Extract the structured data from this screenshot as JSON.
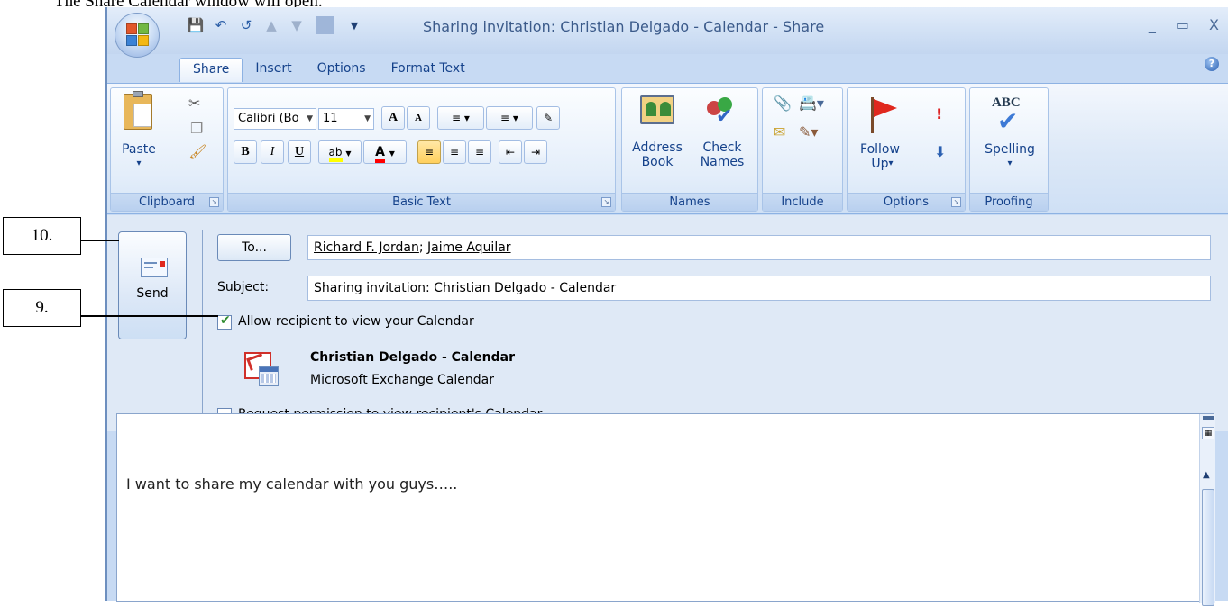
{
  "doc_heading": "The Share Calendar window will open.",
  "window": {
    "title": "Sharing invitation: Christian Delgado - Calendar - Share",
    "controls": [
      "_",
      "▭",
      "X"
    ],
    "help": "?"
  },
  "qat": {
    "save": "save-icon",
    "undo": "undo-icon",
    "redo": "redo-icon",
    "up": "previous-icon",
    "down": "next-icon",
    "customize": "customize-icon"
  },
  "tabs": [
    "Share",
    "Insert",
    "Options",
    "Format Text"
  ],
  "ribbon": {
    "clipboard": {
      "paste": "Paste",
      "paste_arrow": "▾",
      "label": "Clipboard"
    },
    "basic_text": {
      "font": "Calibri (Bo",
      "size": "11",
      "grow": "A",
      "shrink": "A",
      "bold": "B",
      "italic": "I",
      "underline": "U",
      "highlight": "ab",
      "font_color": "A",
      "label": "Basic Text"
    },
    "names": {
      "address_book": "Address Book",
      "check_names": "Check Names",
      "label": "Names"
    },
    "include": {
      "label": "Include"
    },
    "options": {
      "follow_up": "Follow Up",
      "follow_up_arrow": "▾",
      "label": "Options"
    },
    "proofing": {
      "spelling": "Spelling",
      "spelling_arrow": "▾",
      "abc": "ABC",
      "label": "Proofing"
    }
  },
  "form": {
    "send": "Send",
    "to_button": "To...",
    "to_recipients": [
      "Richard F. Jordan",
      "Jaime Aquilar"
    ],
    "to_separator": "; ",
    "subject_label": "Subject:",
    "subject_value": "Sharing invitation: Christian Delgado - Calendar",
    "allow_label": "Allow recipient to view your Calendar",
    "allow_checked": true,
    "calendar_name": "Christian Delgado - Calendar",
    "calendar_type": "Microsoft Exchange Calendar",
    "request_label": "Request permission to view recipient's Calendar",
    "request_checked": false
  },
  "body": {
    "text": "I want to share my calendar with you guys….."
  },
  "callouts": {
    "send": "10.",
    "checkbox": "9."
  }
}
